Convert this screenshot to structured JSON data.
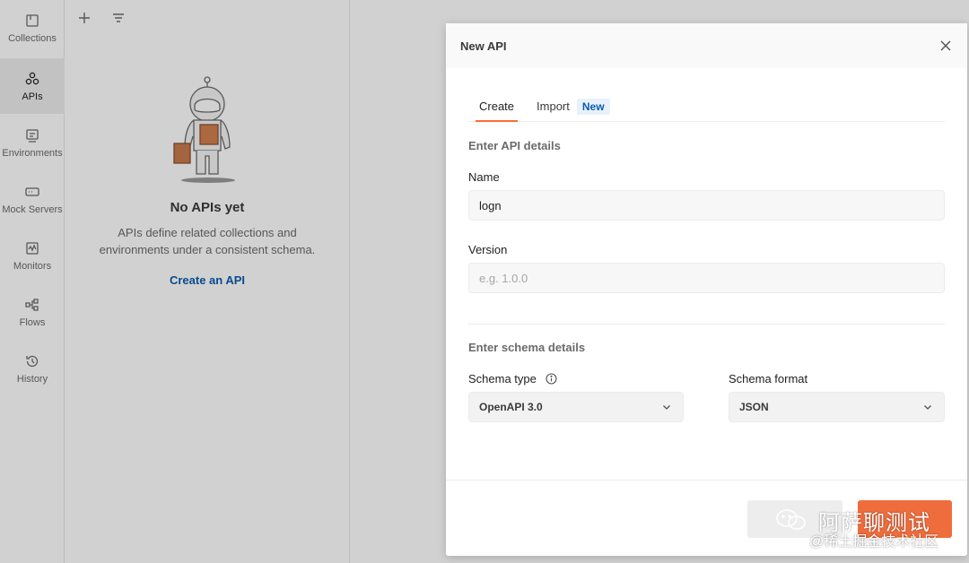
{
  "sidebar": {
    "items": [
      {
        "label": "Collections",
        "icon": "collections-icon",
        "active": false
      },
      {
        "label": "APIs",
        "icon": "apis-icon",
        "active": true
      },
      {
        "label": "Environments",
        "icon": "environments-icon",
        "active": false
      },
      {
        "label": "Mock Servers",
        "icon": "mock-servers-icon",
        "active": false
      },
      {
        "label": "Monitors",
        "icon": "monitors-icon",
        "active": false
      },
      {
        "label": "Flows",
        "icon": "flows-icon",
        "active": false
      },
      {
        "label": "History",
        "icon": "history-icon",
        "active": false
      }
    ]
  },
  "panel": {
    "toolbar": {
      "add_icon": "plus-icon",
      "filter_icon": "filter-icon"
    },
    "empty_state": {
      "title": "No APIs yet",
      "description": "APIs define related collections and environments under a consistent schema.",
      "action": "Create an API"
    }
  },
  "modal": {
    "title": "New API",
    "tabs": [
      {
        "label": "Create",
        "active": true
      },
      {
        "label": "Import",
        "active": false,
        "badge": "New"
      }
    ],
    "api_details": {
      "section_title": "Enter API details",
      "name_label": "Name",
      "name_value": "logn",
      "version_label": "Version",
      "version_placeholder": "e.g. 1.0.0",
      "version_value": ""
    },
    "schema_details": {
      "section_title": "Enter schema details",
      "type_label": "Schema type",
      "type_value": "OpenAPI 3.0",
      "format_label": "Schema format",
      "format_value": "JSON"
    },
    "footer": {
      "cancel_label": "",
      "create_label": ""
    }
  },
  "watermark": {
    "main": "阿萨聊测试",
    "sub": "@稀土掘金技术社区"
  },
  "colors": {
    "accent": "#ff6c37",
    "link": "#0b5cad",
    "primary_button": "#ef6d3d"
  }
}
